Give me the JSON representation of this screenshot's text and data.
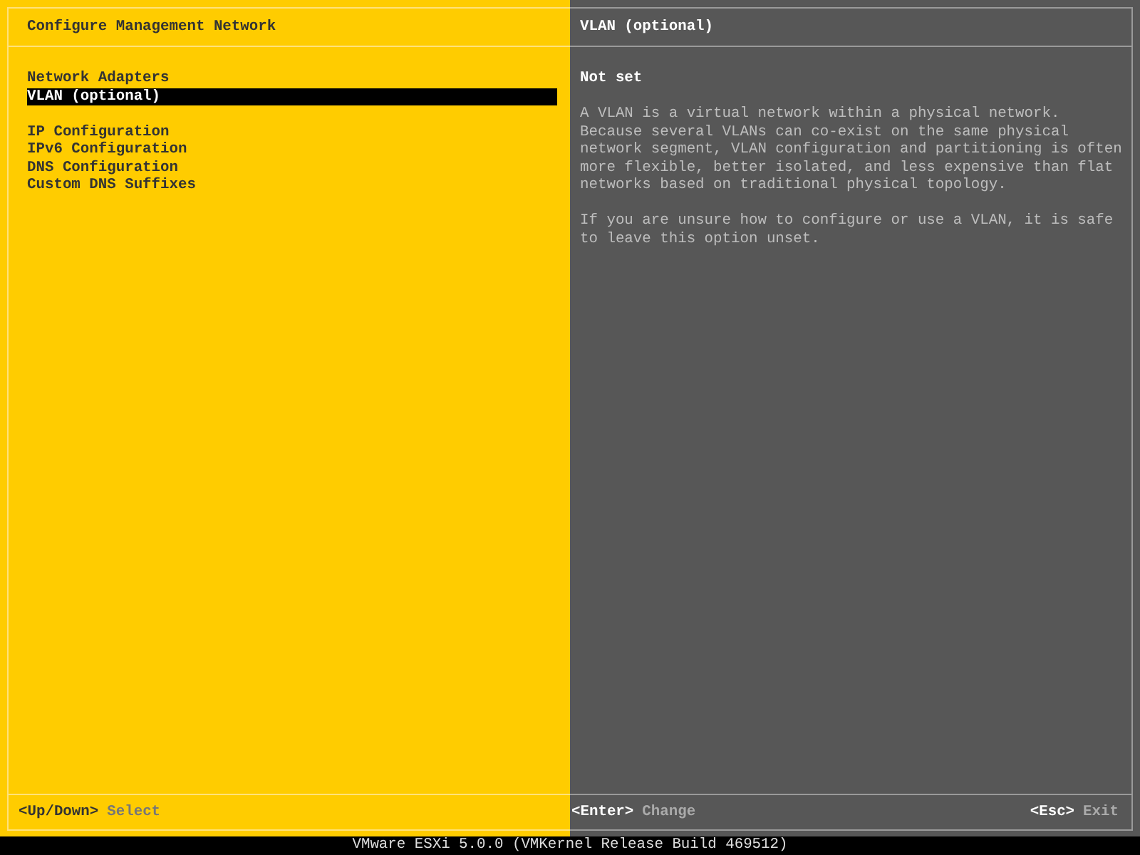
{
  "left_panel": {
    "title": "Configure Management Network",
    "menu_groups": [
      [
        {
          "label": "Network Adapters",
          "selected": false
        },
        {
          "label": "VLAN (optional)",
          "selected": true
        }
      ],
      [
        {
          "label": "IP Configuration",
          "selected": false
        },
        {
          "label": "IPv6 Configuration",
          "selected": false
        },
        {
          "label": "DNS Configuration",
          "selected": false
        },
        {
          "label": "Custom DNS Suffixes",
          "selected": false
        }
      ]
    ],
    "footer": [
      {
        "key": "<Up/Down>",
        "action": "Select"
      }
    ]
  },
  "right_panel": {
    "title": "VLAN (optional)",
    "value": "Not set",
    "paragraphs": [
      "A VLAN is a virtual network within a physical network. Because several VLANs can co-exist on the same physical network segment, VLAN configuration and partitioning is often more flexible, better isolated, and less expensive than flat networks based on traditional physical topology.",
      "If you are unsure how to configure or use a VLAN, it is safe to leave this option unset."
    ],
    "footer": [
      {
        "key": "<Enter>",
        "action": "Change"
      },
      {
        "key": "<Esc>",
        "action": "Exit"
      }
    ]
  },
  "status_bar": "VMware ESXi 5.0.0 (VMKernel Release Build 469512)"
}
